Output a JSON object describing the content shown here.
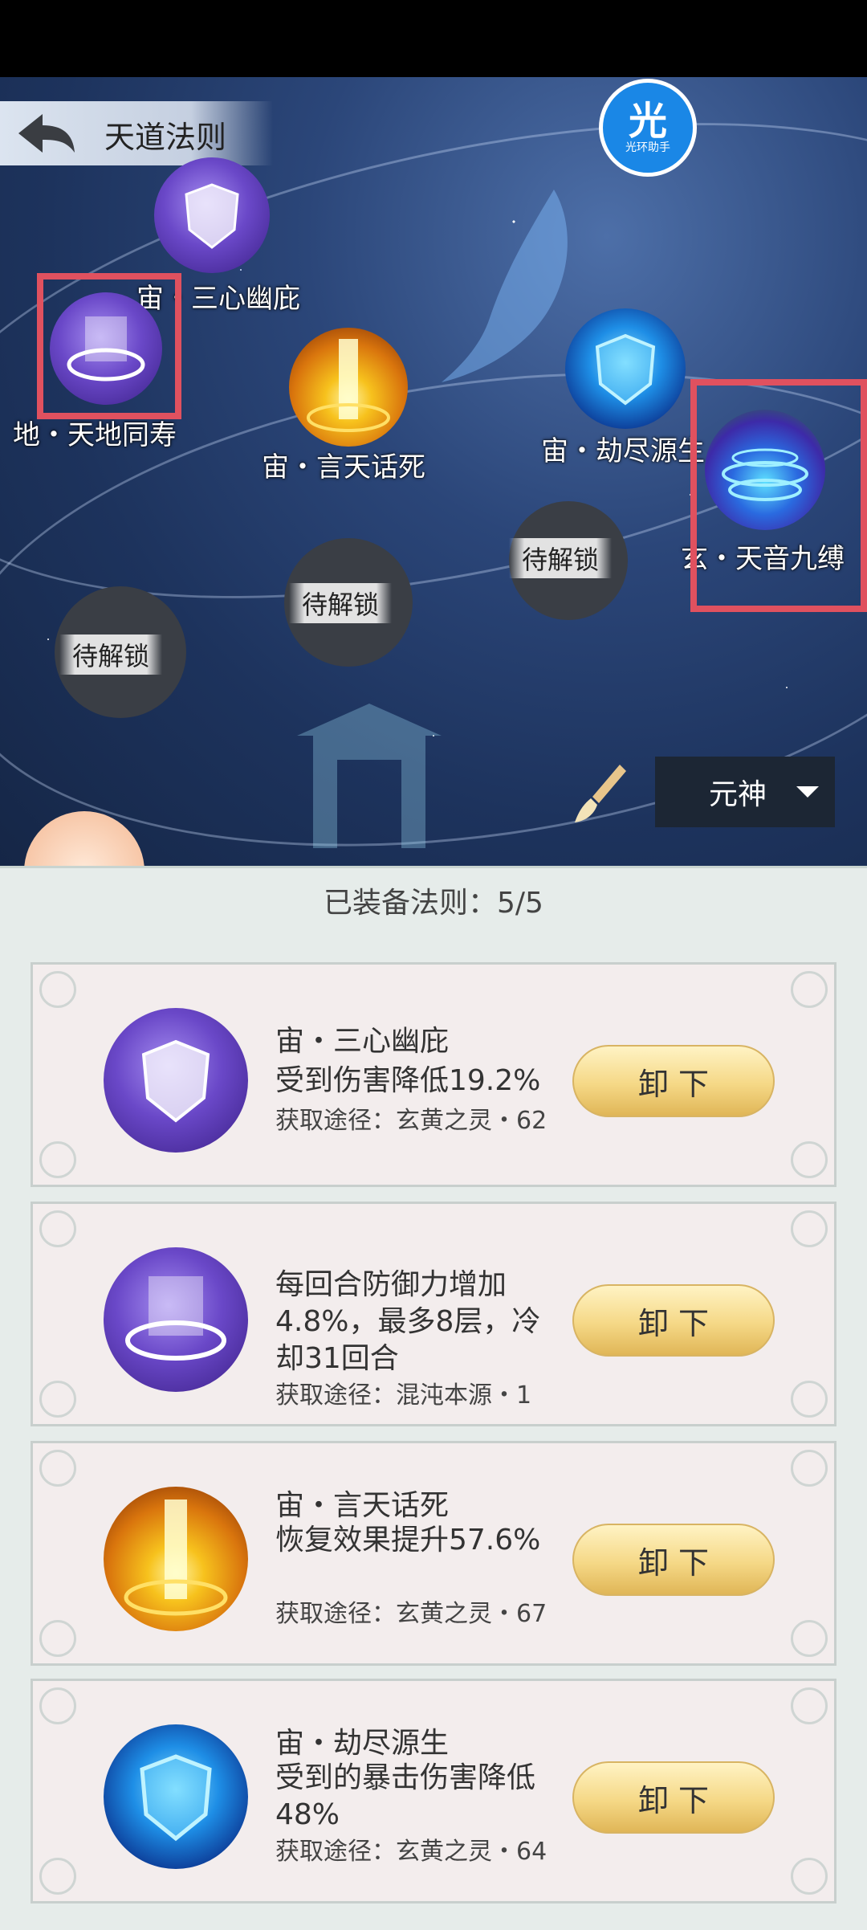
{
  "header": {
    "title": "天道法则",
    "helper_badge_big": "光",
    "helper_badge_small": "光环助手"
  },
  "nodes": [
    {
      "label": "宙・三心幽庇"
    },
    {
      "label": "地・天地同寿"
    },
    {
      "label": "宙・言天话死"
    },
    {
      "label": "宙・劫尽源生"
    },
    {
      "label": "玄・天音九缚"
    }
  ],
  "locked_nodes": [
    "待解锁",
    "待解锁",
    "待解锁"
  ],
  "dropdown": {
    "value": "元神"
  },
  "equipped": {
    "title": "已装备法则：5/5",
    "cards": [
      {
        "name": "宙・三心幽庇",
        "desc": "受到伤害降低19.2%",
        "source": "获取途径：玄黄之灵・62",
        "button": "卸 下"
      },
      {
        "name": "",
        "desc": "每回合防御力增加4.8%，最多8层，冷却31回合",
        "source": "获取途径：混沌本源・1",
        "button": "卸 下"
      },
      {
        "name": "宙・言天话死",
        "desc": "恢复效果提升57.6%",
        "source": "获取途径：玄黄之灵・67",
        "button": "卸 下"
      },
      {
        "name": "宙・劫尽源生",
        "desc": "受到的暴击伤害降低48%",
        "source": "获取途径：玄黄之灵・64",
        "button": "卸 下"
      }
    ]
  },
  "colors": {
    "highlight": "#e0515f",
    "button_gold": "#f5d886",
    "panel_bg": "#e6ecea"
  }
}
